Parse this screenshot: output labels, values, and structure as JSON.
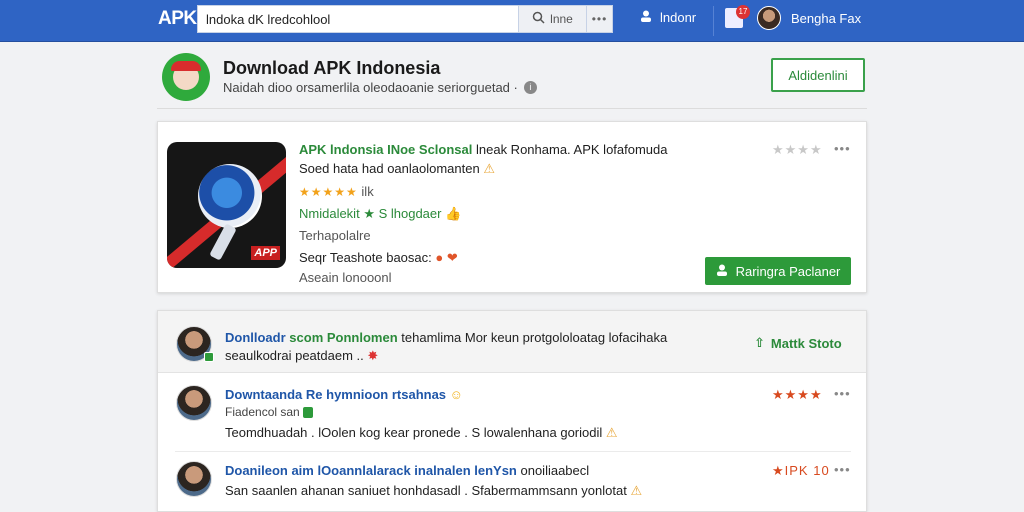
{
  "topbar": {
    "logo": "APK",
    "search_value": "lndoka dK lredcohlool",
    "search_button": "lnne",
    "user_label": "lndonr",
    "notif_count": "17",
    "profile_name": "Bengha Fax"
  },
  "header": {
    "title": "Download APK Indonesia",
    "subtitle": "Naidah dioo orsamerlila oleodaoanie seriorguetad ·"
  },
  "header_button": "Aldidenlini",
  "app_card": {
    "title_green": "APK lndonsia INoe Sclonsal",
    "title_rest": " lneak Ronhama. APK lofafomuda",
    "line2": "Soed hata had oanlaolomanten",
    "rating_text": "ilk",
    "dev_green": "Nmidalekit",
    "dev_rest": "S lhogdaer",
    "category": "Terhapolalre",
    "line5": "Seqr Teashote baosac:",
    "line6": "Aseain lonooonl",
    "install_button": "Raringra Paclaner",
    "icon_tag": "APP"
  },
  "comments_panel": {
    "head_title_bold": "Donlloadr",
    "head_title_green": "scom Ponnlomen",
    "head_title_rest": "tehamlima Mor keun protgololoatag lofacihaka",
    "head_sub": "seaulkodrai peatdaem ..",
    "follow_button": "Mattk Stoto",
    "comments": [
      {
        "title": "Downtaanda Re hymnioon rtsahnas",
        "sub": "Fiadencol san",
        "text": "Teomdhuadah . lOolen kog kear pronede . S lowalenhana goriodil",
        "rating": "★★★★"
      },
      {
        "title": "Doanileon aim lOoannlalarack inalnalen lenYsn",
        "title_rest": " onoiliaabecl",
        "text": "San saanlen ahanan saniuet honhdasadl . Sfabermammsann yonlotat",
        "rating": "★IPK 10"
      }
    ]
  },
  "colors": {
    "topbar": "#2f64c4",
    "accent_green": "#2d9a3a",
    "link_blue": "#1f56a8",
    "star_orange": "#f2a21b"
  }
}
